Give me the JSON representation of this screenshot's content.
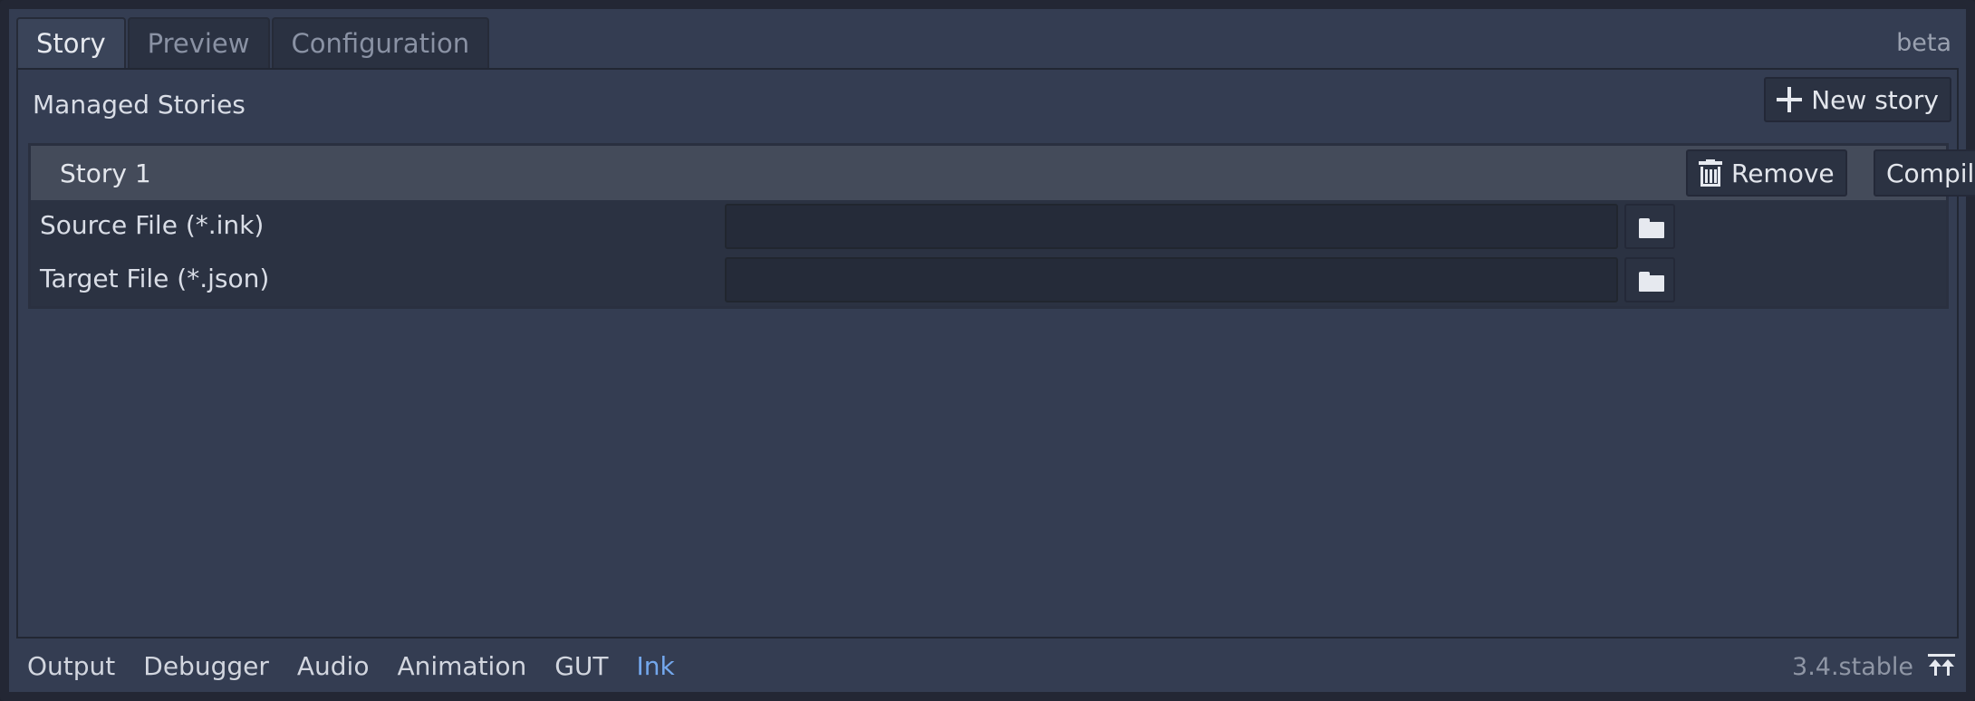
{
  "tabs": [
    {
      "label": "Story",
      "active": true
    },
    {
      "label": "Preview",
      "active": false
    },
    {
      "label": "Configuration",
      "active": false
    }
  ],
  "badge": "beta",
  "managed": {
    "title": "Managed Stories",
    "new_story_label": "New story"
  },
  "story": {
    "name": "Story 1",
    "remove_label": "Remove",
    "compile_label": "Compile",
    "source_label": "Source File (*.ink)",
    "source_value": "",
    "target_label": "Target File (*.json)",
    "target_value": ""
  },
  "bottom_tabs": [
    {
      "label": "Output",
      "active": false
    },
    {
      "label": "Debugger",
      "active": false
    },
    {
      "label": "Audio",
      "active": false
    },
    {
      "label": "Animation",
      "active": false
    },
    {
      "label": "GUT",
      "active": false
    },
    {
      "label": "Ink",
      "active": true
    }
  ],
  "version": "3.4.stable",
  "colors": {
    "accent": "#73a7ec",
    "panel": "#343d52",
    "header": "#444b5a"
  },
  "icons": [
    "plus-icon",
    "trash-icon",
    "folder-icon",
    "collapse-panel-icon"
  ]
}
